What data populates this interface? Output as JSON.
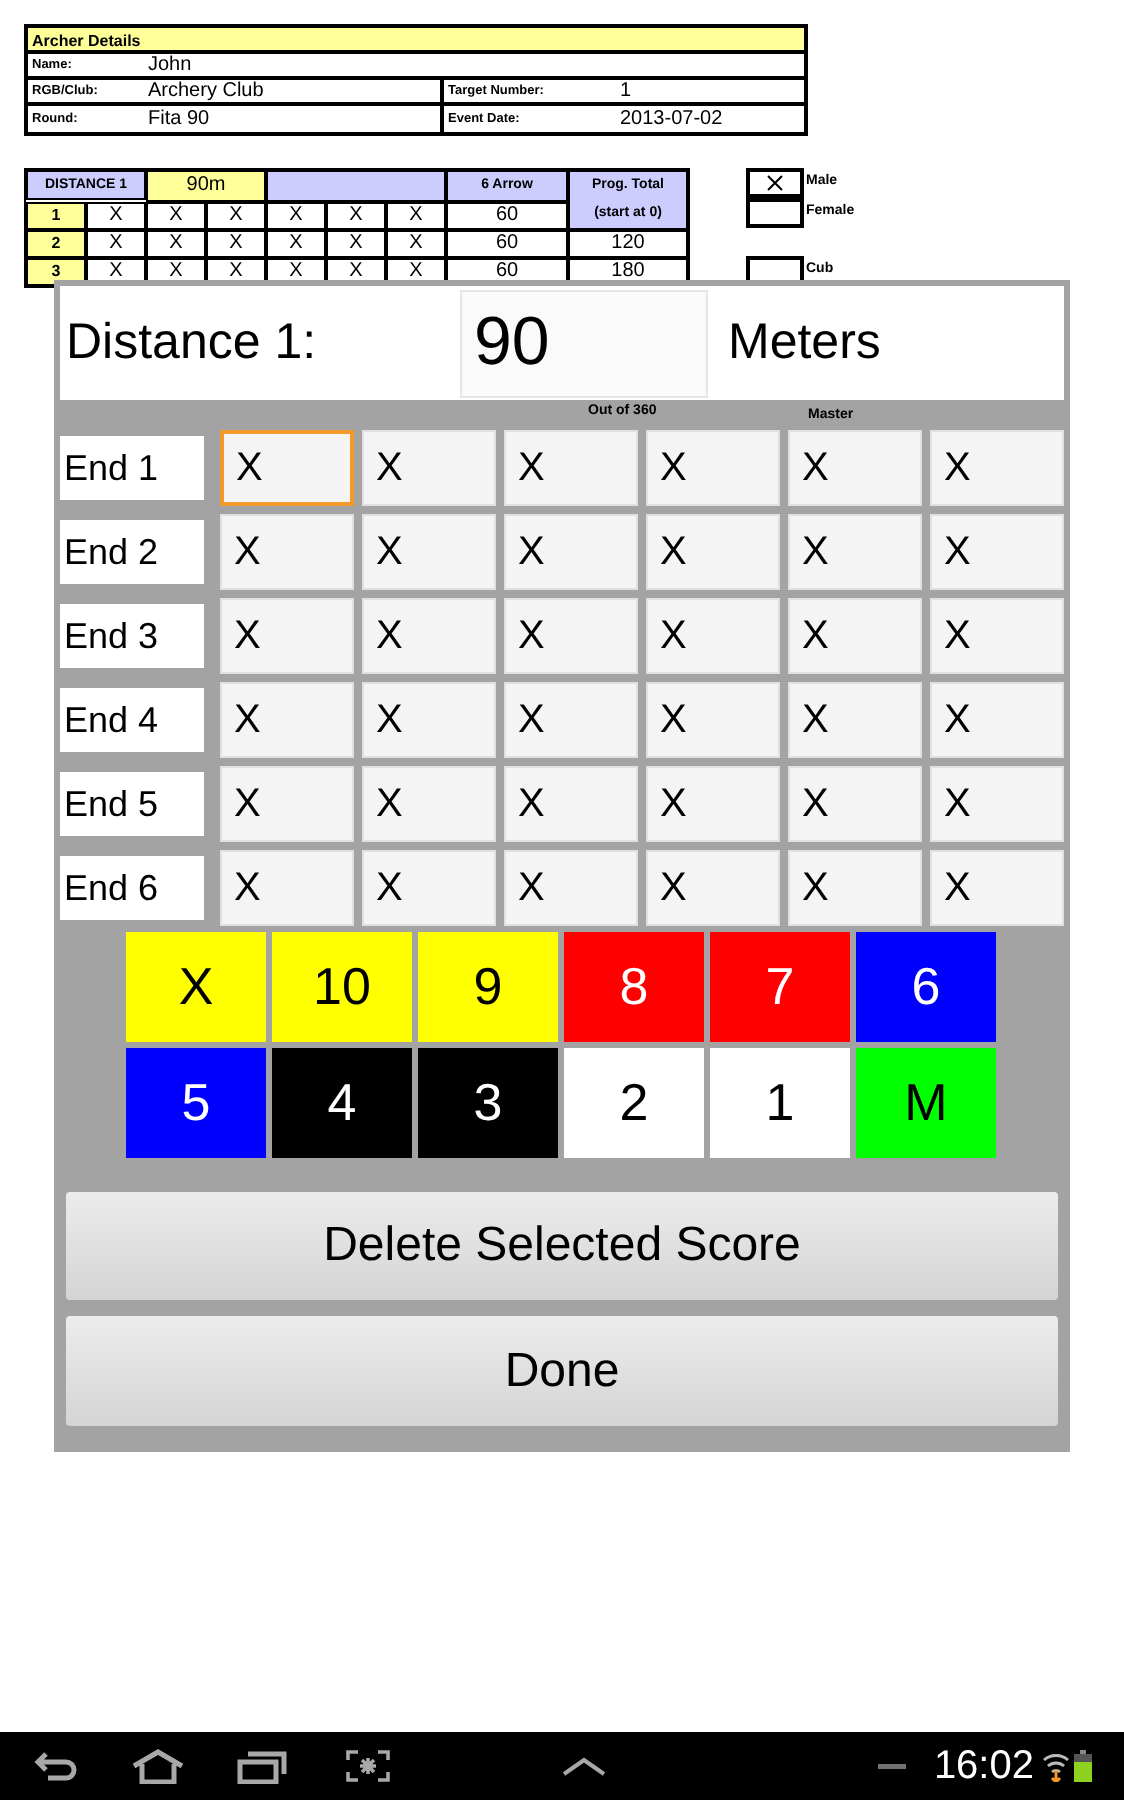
{
  "archer_details": {
    "title": "Archer Details",
    "rows": [
      [
        {
          "label": "Name:",
          "value": "John"
        }
      ],
      [
        {
          "label": "RGB/Club:",
          "value": "Archery Club"
        },
        {
          "label": "Target Number:",
          "value": "1"
        }
      ],
      [
        {
          "label": "Round:",
          "value": "Fita 90"
        },
        {
          "label": "Event Date:",
          "value": "2013-07-02"
        }
      ]
    ]
  },
  "distance_table": {
    "title": "DISTANCE 1",
    "distance": "90m",
    "arrow_header": "6 Arrow",
    "total_header": "Prog. Total",
    "total_subheader": "(start at 0)",
    "rows": [
      {
        "end": "1",
        "arrows": [
          "X",
          "X",
          "X",
          "X",
          "X",
          "X"
        ],
        "total": "60",
        "prog": ""
      },
      {
        "end": "2",
        "arrows": [
          "X",
          "X",
          "X",
          "X",
          "X",
          "X"
        ],
        "total": "60",
        "prog": "120"
      },
      {
        "end": "3",
        "arrows": [
          "X",
          "X",
          "X",
          "X",
          "X",
          "X"
        ],
        "total": "60",
        "prog": "180"
      }
    ]
  },
  "divisions": [
    {
      "label": "Male",
      "checked": true
    },
    {
      "label": "Female",
      "checked": false
    },
    {
      "label": "Cub",
      "checked": false
    }
  ],
  "dialog": {
    "distance_label": "Distance 1:",
    "distance_value": "90",
    "unit": "Meters",
    "out_of": "Out of 360",
    "master_label": "Master",
    "ends": [
      {
        "label": "End 1",
        "scores": [
          {
            "value": "X",
            "selected": true
          },
          {
            "value": "X",
            "selected": false
          },
          {
            "value": "X",
            "selected": false
          },
          {
            "value": "X",
            "selected": false
          },
          {
            "value": "X",
            "selected": false
          },
          {
            "value": "X",
            "selected": false
          }
        ]
      },
      {
        "label": "End 2",
        "scores": [
          {
            "value": "X",
            "selected": false
          },
          {
            "value": "X",
            "selected": false
          },
          {
            "value": "X",
            "selected": false
          },
          {
            "value": "X",
            "selected": false
          },
          {
            "value": "X",
            "selected": false
          },
          {
            "value": "X",
            "selected": false
          }
        ]
      },
      {
        "label": "End 3",
        "scores": [
          {
            "value": "X",
            "selected": false
          },
          {
            "value": "X",
            "selected": false
          },
          {
            "value": "X",
            "selected": false
          },
          {
            "value": "X",
            "selected": false
          },
          {
            "value": "X",
            "selected": false
          },
          {
            "value": "X",
            "selected": false
          }
        ]
      },
      {
        "label": "End 4",
        "scores": [
          {
            "value": "X",
            "selected": false
          },
          {
            "value": "X",
            "selected": false
          },
          {
            "value": "X",
            "selected": false
          },
          {
            "value": "X",
            "selected": false
          },
          {
            "value": "X",
            "selected": false
          },
          {
            "value": "X",
            "selected": false
          }
        ]
      },
      {
        "label": "End 5",
        "scores": [
          {
            "value": "X",
            "selected": false
          },
          {
            "value": "X",
            "selected": false
          },
          {
            "value": "X",
            "selected": false
          },
          {
            "value": "X",
            "selected": false
          },
          {
            "value": "X",
            "selected": false
          },
          {
            "value": "X",
            "selected": false
          }
        ]
      },
      {
        "label": "End 6",
        "scores": [
          {
            "value": "X",
            "selected": false
          },
          {
            "value": "X",
            "selected": false
          },
          {
            "value": "X",
            "selected": false
          },
          {
            "value": "X",
            "selected": false
          },
          {
            "value": "X",
            "selected": false
          },
          {
            "value": "X",
            "selected": false
          }
        ]
      }
    ],
    "score_buttons": [
      {
        "label": "X",
        "color": "#ffff00"
      },
      {
        "label": "10",
        "color": "#ffff00"
      },
      {
        "label": "9",
        "color": "#ffff00"
      },
      {
        "label": "8",
        "color": "#ff0000"
      },
      {
        "label": "7",
        "color": "#ff0000"
      },
      {
        "label": "6",
        "color": "#0000ff"
      },
      {
        "label": "5",
        "color": "#0000ff"
      },
      {
        "label": "4",
        "color": "#000000"
      },
      {
        "label": "3",
        "color": "#000000"
      },
      {
        "label": "2",
        "color": "#ffffff"
      },
      {
        "label": "1",
        "color": "#ffffff"
      },
      {
        "label": "M",
        "color": "#00ff00"
      }
    ],
    "delete_button": "Delete Selected Score",
    "done_button": "Done"
  },
  "status_bar": {
    "time": "16:02"
  }
}
